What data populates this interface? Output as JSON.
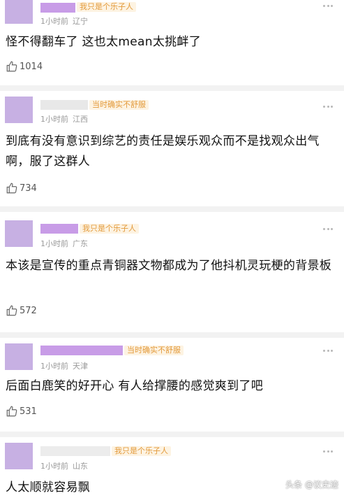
{
  "comments": [
    {
      "tag": "我只是个乐子人",
      "time": "1小时前",
      "location": "辽宁",
      "text": "怪不得翻车了 这也太mean太挑衅了",
      "likes": "1014"
    },
    {
      "tag": "当时确实不舒服",
      "time": "1小时前",
      "location": "江西",
      "text": "到底有没有意识到综艺的责任是娱乐观众而不是找观众出气啊，服了这群人",
      "likes": "734"
    },
    {
      "tag": "我只是个乐子人",
      "time": "1小时前",
      "location": "广东",
      "text": "本该是宣传的重点青铜器文物都成为了他抖机灵玩梗的背景板",
      "likes": "572"
    },
    {
      "tag": "当时确实不舒服",
      "time": "1小时前",
      "location": "天津",
      "text": "后面白鹿笑的好开心 有人给撑腰的感觉爽到了吧",
      "likes": "531"
    },
    {
      "tag": "我只是个乐子人",
      "time": "1小时前",
      "location": "山东",
      "text": "人太顺就容易飘",
      "likes": ""
    }
  ],
  "watermark": "头条 @议史迹",
  "colors": {
    "tag_bg": "#fdf3e2",
    "tag_text": "#e39a3b",
    "redaction": "#c89ce7"
  },
  "icons": {
    "like": "thumbs-up-icon",
    "more": "more-dots-icon"
  }
}
